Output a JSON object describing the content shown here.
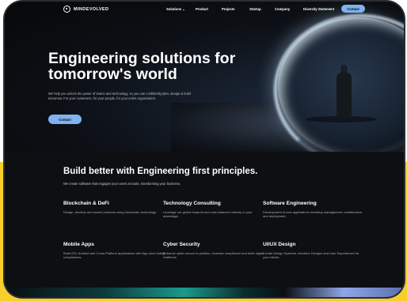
{
  "nav": {
    "logo_text": "MINDEVOLVED",
    "items": [
      "Solutions",
      "Product",
      "Projects",
      "Startup",
      "Company",
      "Diversity Statement"
    ],
    "solutions_caret": "⌄",
    "contact_label": "Contact"
  },
  "hero": {
    "title": "Engineering solutions for tomorrow's world",
    "description": "We help you unlock the power of teams and technology, so you can confidently plan, design & build tomorrow. For your customers, for your people, for your entire organization.",
    "button_label": "Contact"
  },
  "features": {
    "title": "Build better with Engineering first principles.",
    "subtitle": "We create software that engages your users at scale, transforming your business.",
    "tiles": [
      {
        "title": "Blockchain & DeFi",
        "desc": "Design, develop and launch products using blockchain technology."
      },
      {
        "title": "Technology Consulting",
        "desc": "Leverage our global footprint and cost-balanced velocity to your advantage."
      },
      {
        "title": "Software Engineering",
        "desc": "Development of new applications including management, maintenance and deployment."
      },
      {
        "title": "Mobile Apps",
        "desc": "Build iOS, Android and Cross-Platform applications with App-store-listing compliances."
      },
      {
        "title": "Cyber Security",
        "desc": "Enhance cyber-secure to position, increase compliance and build digital resilience."
      },
      {
        "title": "UI/UX Design",
        "desc": "Create Design Systems, interface Designs and User Experiences for your clients."
      }
    ]
  },
  "colors": {
    "accent": "#7fb2f0",
    "background": "#0e0f12",
    "page_bg": "#f6cf2c"
  }
}
